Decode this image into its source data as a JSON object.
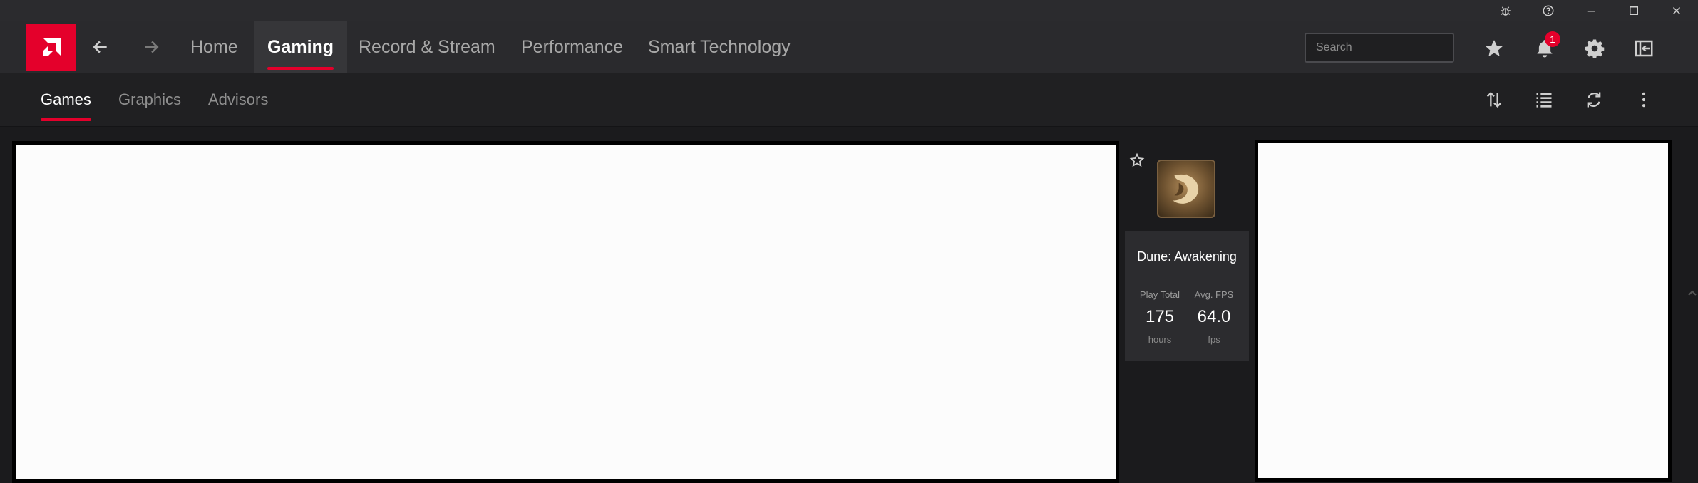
{
  "titlebar": {
    "icons": [
      "bug-icon",
      "help-icon",
      "minimize-icon",
      "maximize-icon",
      "close-icon"
    ]
  },
  "navbar": {
    "logo": "amd-logo",
    "tabs": [
      {
        "label": "Home"
      },
      {
        "label": "Gaming"
      },
      {
        "label": "Record & Stream"
      },
      {
        "label": "Performance"
      },
      {
        "label": "Smart Technology"
      }
    ],
    "active_tab": "Gaming",
    "search": {
      "placeholder": "Search",
      "value": ""
    },
    "notification_count": "1",
    "right_icons": [
      "star-icon",
      "bell-icon",
      "gear-icon",
      "sidebar-toggle-icon"
    ]
  },
  "subnav": {
    "tabs": [
      {
        "label": "Games"
      },
      {
        "label": "Graphics"
      },
      {
        "label": "Advisors"
      }
    ],
    "active_tab": "Games",
    "icons": [
      "sort-icon",
      "list-view-icon",
      "refresh-icon",
      "more-icon"
    ]
  },
  "game": {
    "title": "Dune: Awakening",
    "stats": [
      {
        "label": "Play Total",
        "value": "175",
        "unit": "hours"
      },
      {
        "label": "Avg. FPS",
        "value": "64.0",
        "unit": "fps"
      }
    ]
  },
  "colors": {
    "accent": "#e4002b",
    "navbar_bg": "#2a2a2d",
    "content_bg": "#1b1b1d"
  }
}
